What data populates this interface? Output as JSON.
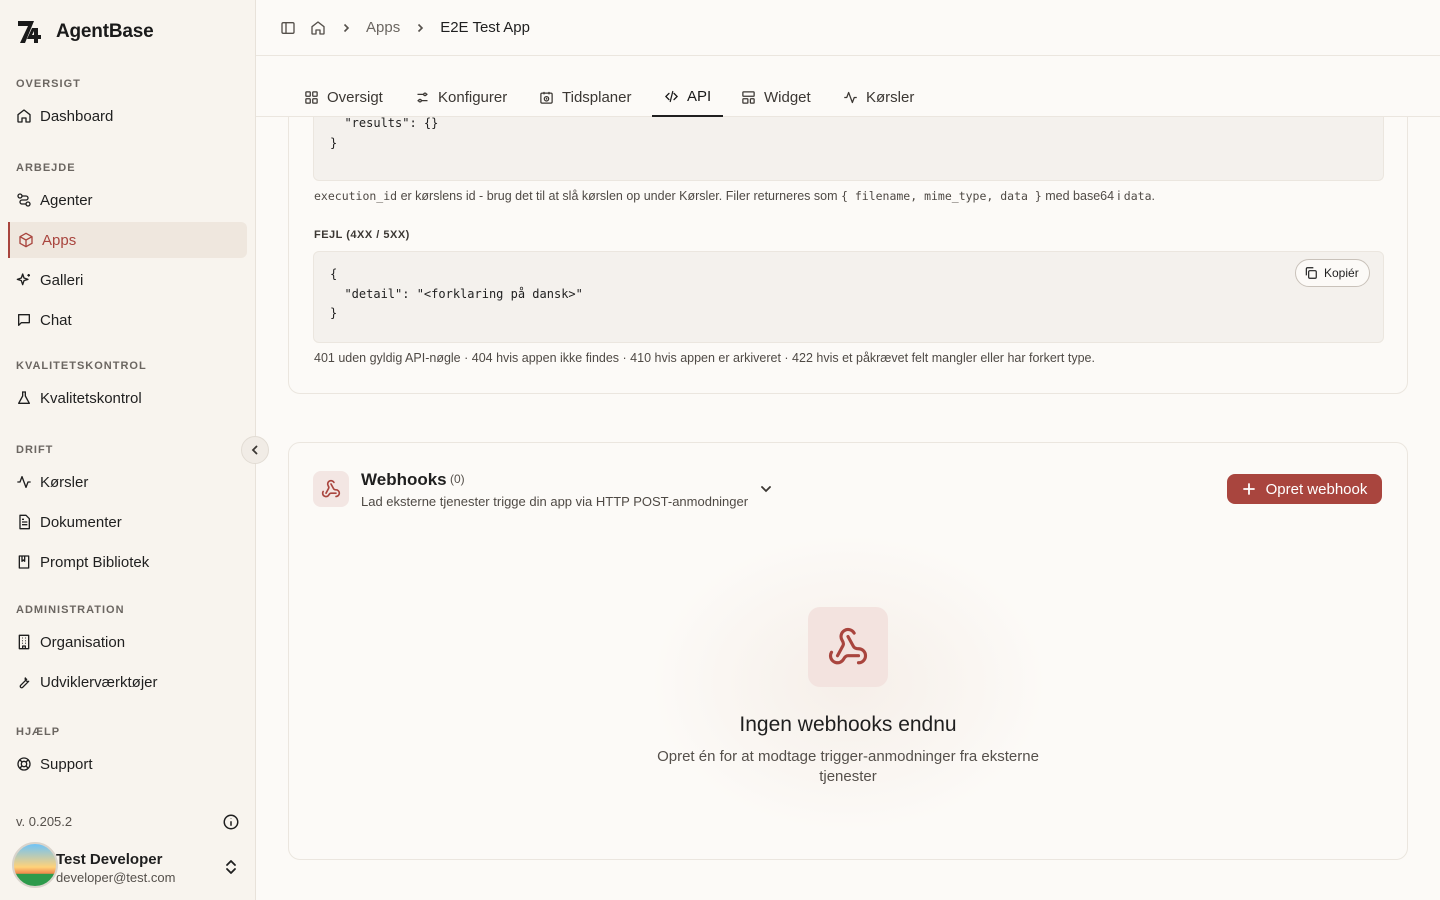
{
  "app": {
    "name": "AgentBase"
  },
  "sidebar": {
    "sections": [
      {
        "title": "OVERSIGT",
        "items": [
          {
            "label": "Dashboard",
            "icon": "home-icon"
          }
        ]
      },
      {
        "title": "ARBEJDE",
        "items": [
          {
            "label": "Agenter",
            "icon": "workflow-icon"
          },
          {
            "label": "Apps",
            "icon": "box-icon",
            "active": true
          },
          {
            "label": "Galleri",
            "icon": "sparkles-icon"
          },
          {
            "label": "Chat",
            "icon": "message-square-icon"
          }
        ]
      },
      {
        "title": "KVALITETSKONTROL",
        "items": [
          {
            "label": "Kvalitetskontrol",
            "icon": "flask-icon"
          }
        ]
      },
      {
        "title": "DRIFT",
        "items": [
          {
            "label": "Kørsler",
            "icon": "activity-icon"
          },
          {
            "label": "Dokumenter",
            "icon": "file-text-icon"
          },
          {
            "label": "Prompt Bibliotek",
            "icon": "book-icon"
          }
        ]
      },
      {
        "title": "ADMINISTRATION",
        "items": [
          {
            "label": "Organisation",
            "icon": "building-icon"
          },
          {
            "label": "Udviklerværktøjer",
            "icon": "wrench-icon"
          }
        ]
      },
      {
        "title": "HJÆLP",
        "items": [
          {
            "label": "Support",
            "icon": "life-buoy-icon"
          }
        ]
      }
    ],
    "version": "v. 0.205.2",
    "user": {
      "name": "Test Developer",
      "email": "developer@test.com"
    }
  },
  "header": {
    "breadcrumb": [
      "Apps",
      "E2E Test App"
    ]
  },
  "tabs": [
    {
      "label": "Oversigt",
      "icon": "layout-grid-icon"
    },
    {
      "label": "Konfigurer",
      "icon": "sliders-icon"
    },
    {
      "label": "Tidsplaner",
      "icon": "calendar-clock-icon"
    },
    {
      "label": "API",
      "icon": "code-icon",
      "active": true
    },
    {
      "label": "Widget",
      "icon": "layout-template-icon"
    },
    {
      "label": "Kørsler",
      "icon": "activity-icon"
    }
  ],
  "api": {
    "response_code_tail": "  \"results\": {}\n}",
    "response_note_1": "execution_id",
    "response_note_2": " er kørslens id - brug det til at slå kørslen op under Kørsler. Filer returneres som ",
    "response_note_3": "{ filename, mime_type, data }",
    "response_note_4": " med base64 i ",
    "response_note_5": "data",
    "response_note_6": ".",
    "error_title": "FEJL (4XX / 5XX)",
    "error_code": "{\n  \"detail\": \"<forklaring på dansk>\"\n}",
    "copy_label": "Kopiér",
    "error_note": "401 uden gyldig API-nøgle · 404 hvis appen ikke findes · 410 hvis appen er arkiveret · 422 hvis et påkrævet felt mangler eller har forkert type."
  },
  "webhooks": {
    "title": "Webhooks",
    "count": "(0)",
    "subtitle": "Lad eksterne tjenester trigge din app via HTTP POST-anmodninger",
    "create_label": "Opret webhook",
    "empty_title": "Ingen webhooks endnu",
    "empty_subtitle": "Opret én for at modtage trigger-anmodninger fra eksterne tjenester"
  },
  "colors": {
    "accent": "#a9453e",
    "background": "#fcfaf7",
    "sidebar": "#f8f4ee"
  }
}
